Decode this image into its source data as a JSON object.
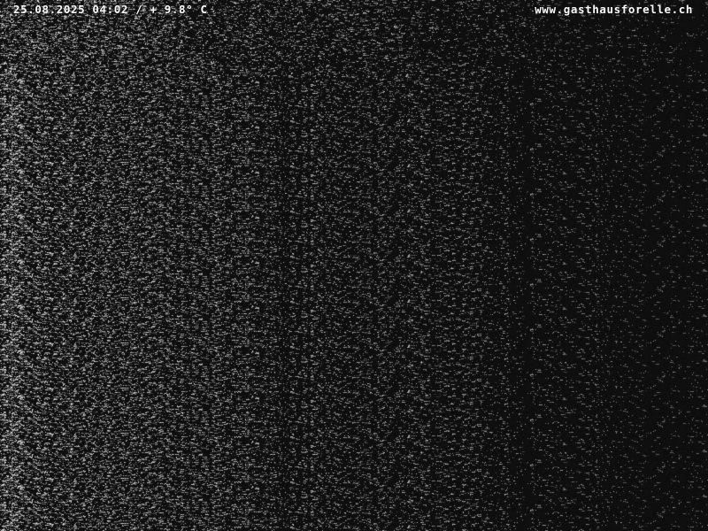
{
  "webcam": {
    "timestamp": "25.08.2025 04:02",
    "separator": "/",
    "temperature": "+ 9.8° C",
    "site_url": "www.gasthausforelle.ch"
  },
  "colors": {
    "background": "#0c0c0c",
    "noise": "#ffffff",
    "overlay_text": "#ffffff"
  }
}
